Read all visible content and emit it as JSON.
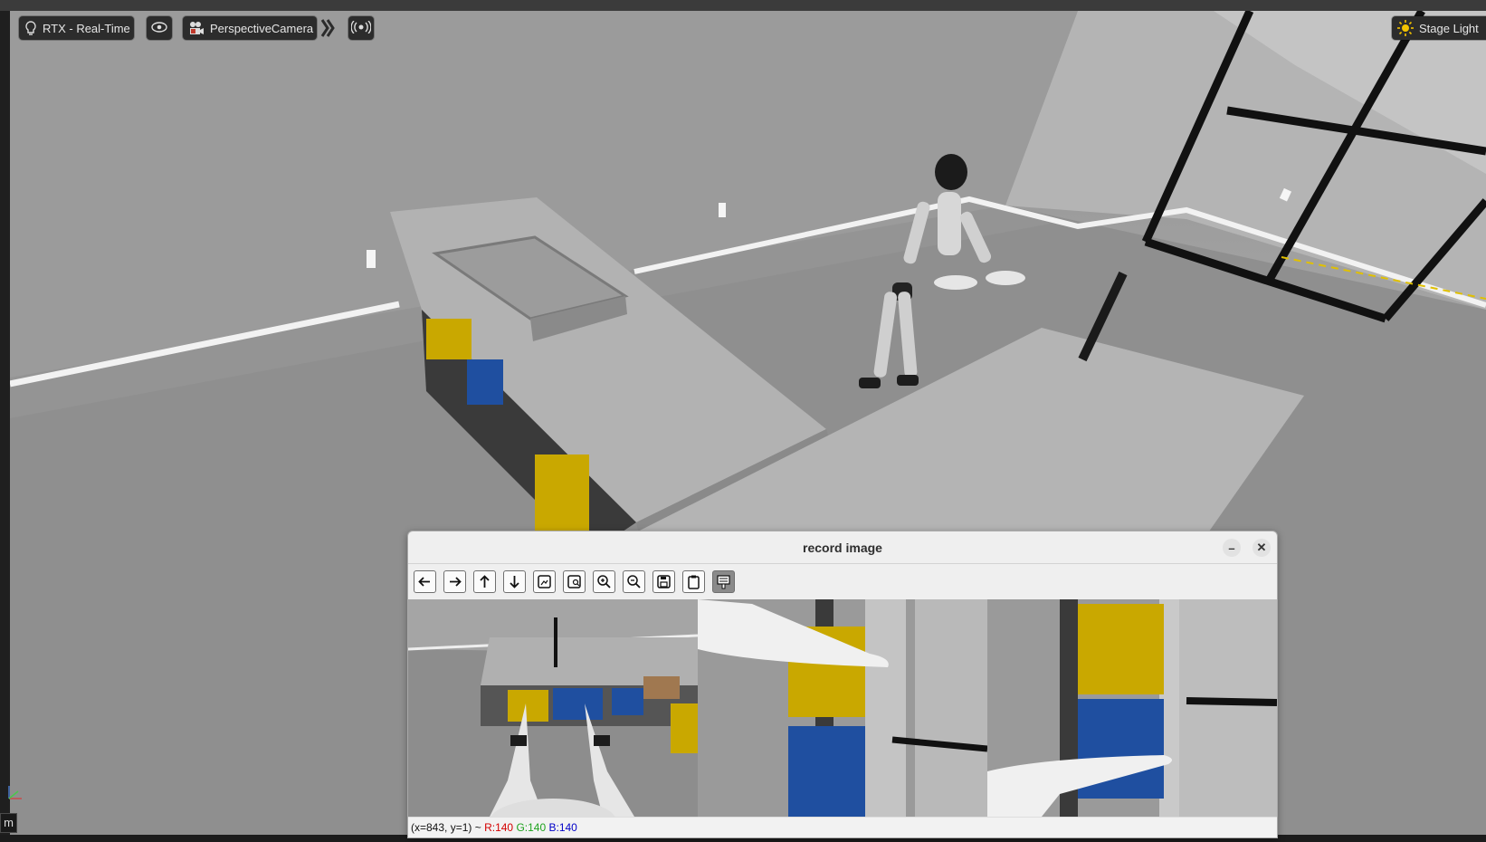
{
  "toolbar": {
    "renderer_label": "RTX - Real-Time",
    "camera_label": "PerspectiveCamera",
    "lighting_label": "Stage Light",
    "icons": [
      "lightbulb-icon",
      "eye-icon",
      "camera-icon",
      "double-chevron-icon",
      "audio-icon",
      "sun-icon"
    ]
  },
  "corner_label": "m",
  "record_window": {
    "title": "record image",
    "minimize_label": "–",
    "close_label": "✕",
    "tools": [
      "arrow-left-icon",
      "arrow-right-icon",
      "arrow-up-icon",
      "arrow-down-icon",
      "fit-image-icon",
      "zoom-image-icon",
      "zoom-in-icon",
      "zoom-out-icon",
      "save-icon",
      "clipboard-icon",
      "properties-icon"
    ],
    "status": {
      "coords": "(x=843, y=1) ~",
      "r": "R:140",
      "g": "G:140",
      "b": "B:140"
    }
  },
  "colors": {
    "toolbar_bg": "#2c2c2c",
    "viewport_gray": "#9a9a9a",
    "status_r": "#d40000",
    "status_g": "#1ea21e",
    "status_b": "#0000c8"
  }
}
